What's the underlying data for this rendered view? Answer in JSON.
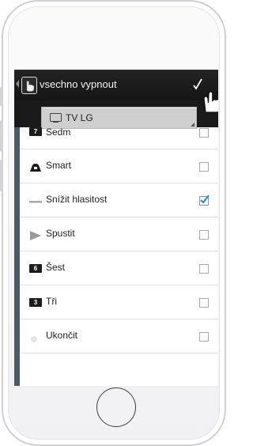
{
  "app": {
    "title": "vsechno vypnout",
    "device": "TV LG",
    "back_icon": "back-arrow-icon",
    "app_icon": "hand-pointer-icon",
    "action_icon": "check-icon"
  },
  "list": {
    "items": [
      {
        "label": "Sedm",
        "icon": "number-badge-icon",
        "badge": "7",
        "checked": false
      },
      {
        "label": "Smart",
        "icon": "smart-icon",
        "badge": "",
        "checked": false
      },
      {
        "label": "Snížit hlasitost",
        "icon": "minus-icon",
        "badge": "",
        "checked": true
      },
      {
        "label": "Spustit",
        "icon": "play-icon",
        "badge": "",
        "checked": false
      },
      {
        "label": "Šest",
        "icon": "number-badge-icon",
        "badge": "6",
        "checked": false
      },
      {
        "label": "Tři",
        "icon": "number-badge-icon",
        "badge": "3",
        "checked": false
      },
      {
        "label": "Ukončit",
        "icon": "exit-icon",
        "badge": "",
        "checked": false
      }
    ]
  },
  "colors": {
    "actionbar": "#1b1b1b",
    "rail": "#4e5966",
    "check_accent": "#2f8fd0"
  }
}
